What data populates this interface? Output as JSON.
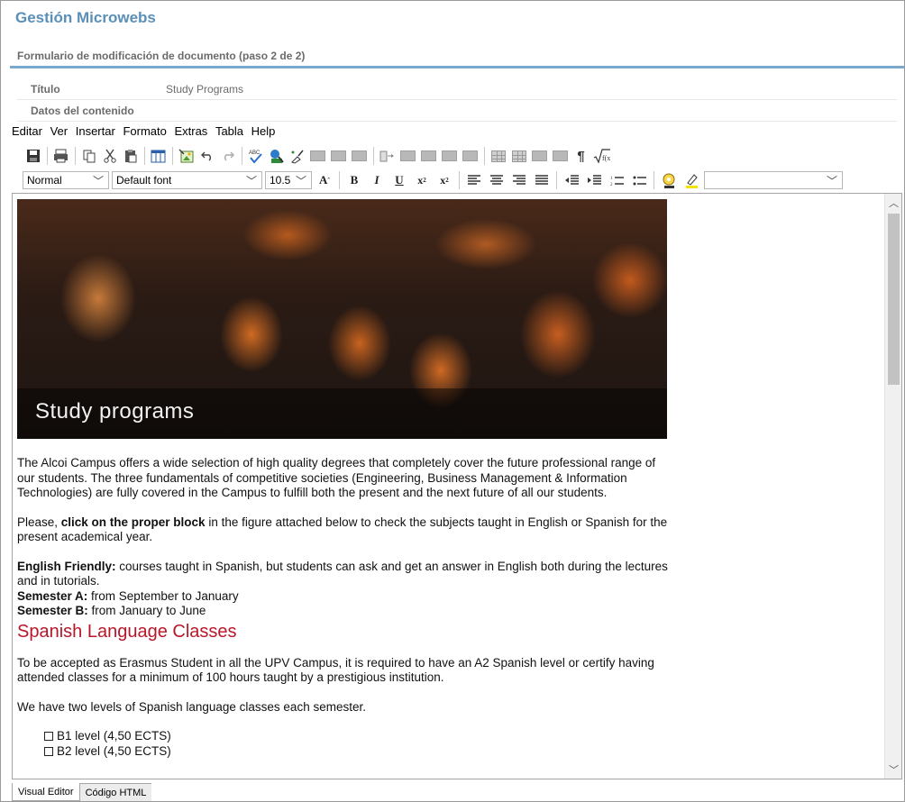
{
  "app": {
    "title": "Gestión Microwebs"
  },
  "form": {
    "title": "Formulario de modificación de documento (paso 2 de 2)"
  },
  "fields": {
    "title_label": "Título",
    "title_value": "Study Programs",
    "content_label": "Datos del contenido"
  },
  "menu": [
    "Editar",
    "Ver",
    "Insertar",
    "Formato",
    "Extras",
    "Tabla",
    "Help"
  ],
  "format_bar": {
    "paragraph_style": "Normal",
    "font": "Default font",
    "size": "10.5",
    "color_value": ""
  },
  "editor": {
    "hero_caption": "Study programs",
    "para1": "The Alcoi Campus offers a wide selection of high quality degrees that completely cover the future professional range of our students. The three fundamentals of competitive societies (Engineering, Business Management & Information Technologies) are fully covered in the Campus to fulfill both the present and the next future of all our students.",
    "para2_pre": "Please, ",
    "para2_bold": "click on the proper block",
    "para2_post": " in the figure attached below to check the subjects taught in English or Spanish for the present academical year.",
    "ef_label": "English Friendly:",
    "ef_text": " courses taught in Spanish, but students can ask and get an answer in English both during the lectures and in tutorials.",
    "semA_label": "Semester A:",
    "semA_text": " from September to January",
    "semB_label": "Semester B:",
    "semB_text": " from January to June",
    "heading": "Spanish Language Classes",
    "para3": "To be accepted as Erasmus Student in all the UPV Campus, it is required to have an A2 Spanish level or certify having attended classes for a minimum of 100 hours taught by a prestigious institution.",
    "para4": "We have two levels of Spanish language classes each semester.",
    "list": [
      "B1 level (4,50 ECTS)",
      "B2 level (4,50 ECTS)"
    ]
  },
  "tabs": [
    "Visual Editor",
    "Código HTML"
  ],
  "colors": {
    "app_title": "#5a8fb8",
    "rule": "#7aa9cf",
    "heading": "#b8172a"
  }
}
